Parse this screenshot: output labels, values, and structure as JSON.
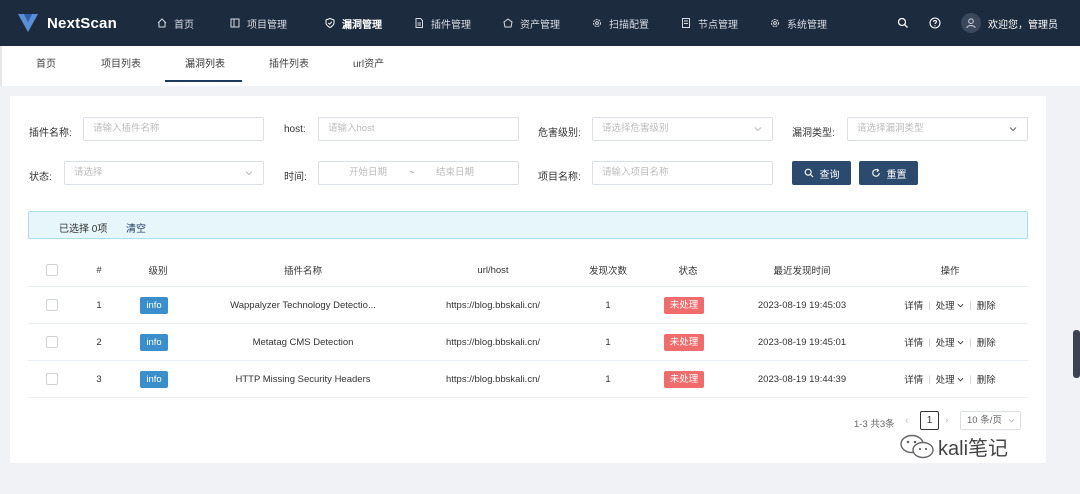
{
  "app": {
    "name": "NextScan"
  },
  "nav": {
    "items": [
      {
        "label": "首页",
        "icon": "home-icon"
      },
      {
        "label": "项目管理",
        "icon": "project-icon"
      },
      {
        "label": "漏洞管理",
        "icon": "shield-icon",
        "active": true
      },
      {
        "label": "插件管理",
        "icon": "plugin-file-icon"
      },
      {
        "label": "资产管理",
        "icon": "asset-icon"
      },
      {
        "label": "扫描配置",
        "icon": "gear-icon"
      },
      {
        "label": "节点管理",
        "icon": "node-icon"
      },
      {
        "label": "系统管理",
        "icon": "gear-icon"
      }
    ],
    "welcome": "欢迎您，管理员"
  },
  "tabs": [
    "首页",
    "项目列表",
    "漏洞列表",
    "插件列表",
    "url资产"
  ],
  "filters": {
    "plugin_name": {
      "label": "插件名称:",
      "placeholder": "请输入插件名称"
    },
    "host": {
      "label": "host:",
      "placeholder": "请输入host"
    },
    "severity": {
      "label": "危害级别:",
      "placeholder": "请选择危害级别"
    },
    "vuln_type": {
      "label": "漏洞类型:",
      "placeholder": "请选择漏洞类型"
    },
    "status": {
      "label": "状态:",
      "placeholder": "请选择"
    },
    "time": {
      "label": "时间:",
      "start": "开始日期",
      "sep": "~",
      "end": "结束日期"
    },
    "project_name": {
      "label": "项目名称:",
      "placeholder": "请输入项目名称"
    },
    "query_label": "查询",
    "reset_label": "重置"
  },
  "selection": {
    "text": "已选择 0项",
    "clear": "清空"
  },
  "table": {
    "headers": [
      "#",
      "级别",
      "插件名称",
      "url/host",
      "发现次数",
      "状态",
      "最近发现时间",
      "操作"
    ],
    "rows": [
      {
        "idx": "1",
        "level": "info",
        "plugin": "Wappalyzer Technology Detectio...",
        "url": "https://blog.bbskali.cn/",
        "count": "1",
        "status": "未处理",
        "time": "2023-08-19 19:45:03"
      },
      {
        "idx": "2",
        "level": "info",
        "plugin": "Metatag CMS Detection",
        "url": "https://blog.bbskali.cn/",
        "count": "1",
        "status": "未处理",
        "time": "2023-08-19 19:45:01"
      },
      {
        "idx": "3",
        "level": "info",
        "plugin": "HTTP Missing Security Headers",
        "url": "https://blog.bbskali.cn/",
        "count": "1",
        "status": "未处理",
        "time": "2023-08-19 19:44:39"
      }
    ],
    "ops": {
      "detail": "详情",
      "handle": "处理",
      "delete": "删除"
    }
  },
  "pagination": {
    "total": "1-3 共3条",
    "page": "1",
    "size": "10 条/页"
  },
  "watermark": "kali笔记",
  "colors": {
    "nav_bg": "#1d2b3f",
    "primary": "#2c4a6e",
    "info": "#3a8ec9",
    "status_unhandled": "#f06b6b"
  }
}
